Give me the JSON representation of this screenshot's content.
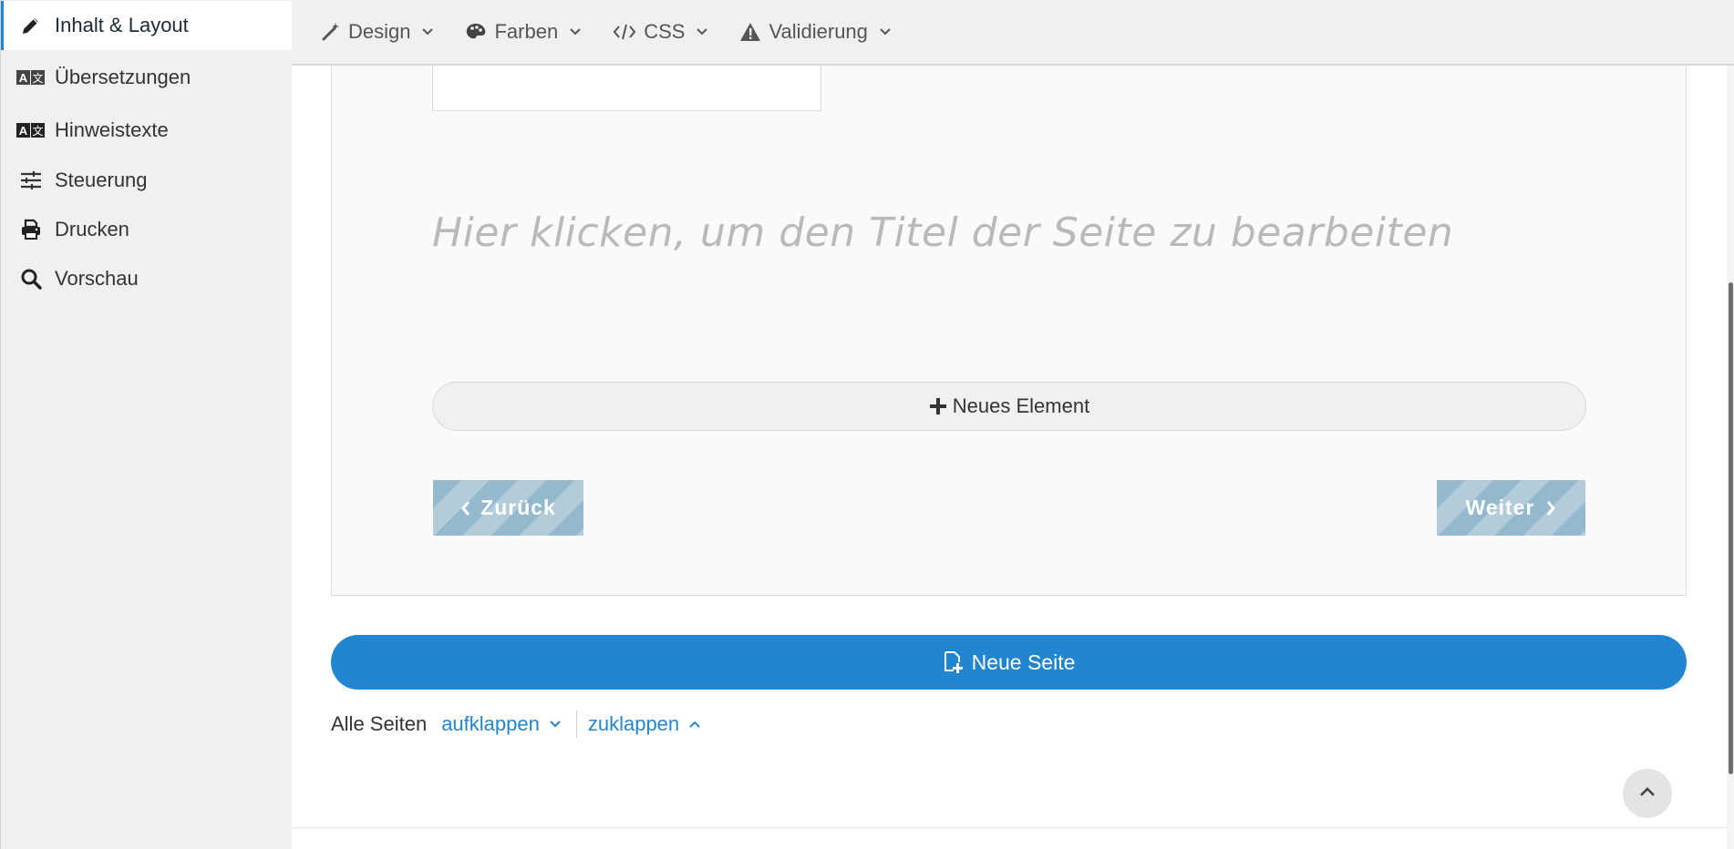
{
  "sidebar": {
    "items": [
      {
        "label": "Inhalt & Layout",
        "icon": "pencil-icon"
      },
      {
        "label": "Übersetzungen",
        "icon": "translate-icon"
      },
      {
        "label": "Hinweistexte",
        "icon": "translate-icon"
      },
      {
        "label": "Steuerung",
        "icon": "sliders-icon"
      },
      {
        "label": "Drucken",
        "icon": "printer-icon"
      },
      {
        "label": "Vorschau",
        "icon": "search-icon"
      }
    ]
  },
  "toolbar": {
    "items": [
      {
        "label": "Design",
        "icon": "magic-wand-icon"
      },
      {
        "label": "Farben",
        "icon": "palette-icon"
      },
      {
        "label": "CSS",
        "icon": "code-icon"
      },
      {
        "label": "Validierung",
        "icon": "warning-icon"
      }
    ]
  },
  "main": {
    "page_title_placeholder": "Hier klicken, um den Titel der Seite zu bearbeiten",
    "new_element_label": "Neues Element",
    "back_label": "Zurück",
    "next_label": "Weiter",
    "new_page_label": "Neue Seite"
  },
  "pages": {
    "label": "Alle Seiten",
    "expand_label": "aufklappen",
    "collapse_label": "zuklappen"
  },
  "colors": {
    "accent": "#2185d0",
    "nav_button": "#94b9cc",
    "sidebar_bg": "#eff0ef"
  }
}
